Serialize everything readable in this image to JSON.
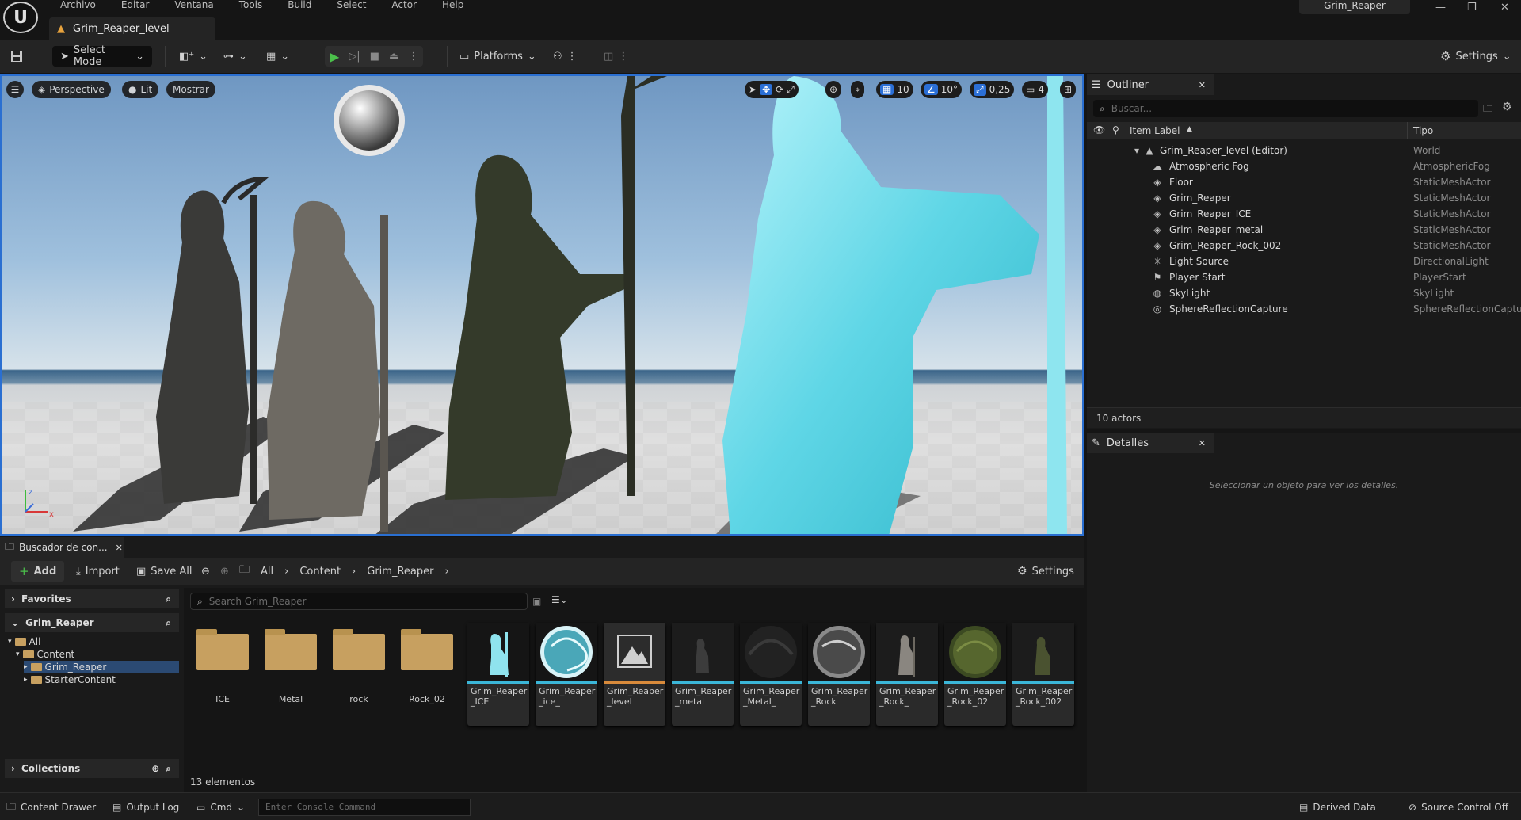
{
  "menu": [
    "Archivo",
    "Editar",
    "Ventana",
    "Tools",
    "Build",
    "Select",
    "Actor",
    "Help"
  ],
  "level_tab": "Grim_Reaper_level",
  "project_name": "Grim_Reaper",
  "toolbar": {
    "select_mode": "Select Mode",
    "platforms": "Platforms",
    "settings": "Settings"
  },
  "viewport": {
    "perspective": "Perspective",
    "lit": "Lit",
    "show": "Mostrar",
    "grid_snap": "10",
    "rot_snap": "10°",
    "scale_snap": "0,25",
    "camera_speed": "4"
  },
  "outliner": {
    "tab": "Outliner",
    "search_placeholder": "Buscar...",
    "col_label": "Item Label",
    "col_type": "Tipo",
    "root": {
      "label": "Grim_Reaper_level (Editor)",
      "type": "World"
    },
    "items": [
      {
        "label": "Atmospheric Fog",
        "type": "AtmosphericFog",
        "icon": "cloud-icon"
      },
      {
        "label": "Floor",
        "type": "StaticMeshActor",
        "icon": "cube-icon"
      },
      {
        "label": "Grim_Reaper",
        "type": "StaticMeshActor",
        "icon": "cube-icon"
      },
      {
        "label": "Grim_Reaper_ICE",
        "type": "StaticMeshActor",
        "icon": "cube-icon"
      },
      {
        "label": "Grim_Reaper_metal",
        "type": "StaticMeshActor",
        "icon": "cube-icon"
      },
      {
        "label": "Grim_Reaper_Rock_002",
        "type": "StaticMeshActor",
        "icon": "cube-icon"
      },
      {
        "label": "Light Source",
        "type": "DirectionalLight",
        "icon": "sun-icon"
      },
      {
        "label": "Player Start",
        "type": "PlayerStart",
        "icon": "flag-icon"
      },
      {
        "label": "SkyLight",
        "type": "SkyLight",
        "icon": "skylight-icon"
      },
      {
        "label": "SphereReflectionCapture",
        "type": "SphereReflectionCapture",
        "icon": "sphere-icon"
      }
    ],
    "count": "10 actors"
  },
  "details": {
    "tab": "Detalles",
    "empty": "Seleccionar un objeto para ver los detalles."
  },
  "content_browser": {
    "tab": "Buscador de con...",
    "add": "Add",
    "import": "Import",
    "save_all": "Save All",
    "breadcrumb": [
      "All",
      "Content",
      "Grim_Reaper"
    ],
    "settings": "Settings",
    "favorites": "Favorites",
    "section": "Grim_Reaper",
    "tree": {
      "all": "All",
      "content": "Content",
      "grim": "Grim_Reaper",
      "starter": "StarterContent"
    },
    "collections": "Collections",
    "search_placeholder": "Search Grim_Reaper",
    "folders": [
      "ICE",
      "Metal",
      "rock",
      "Rock_02"
    ],
    "assets": [
      {
        "name": "Grim_Reaper_ICE",
        "bar": "#3bb6d8"
      },
      {
        "name": "Grim_Reaper_ice_",
        "bar": "#3bb6d8"
      },
      {
        "name": "Grim_Reaper_level",
        "bar": "#d88a3b"
      },
      {
        "name": "Grim_Reaper_metal",
        "bar": "#3bb6d8"
      },
      {
        "name": "Grim_Reaper_Metal_",
        "bar": "#3bb6d8"
      },
      {
        "name": "Grim_Reaper_Rock",
        "bar": "#3bb6d8"
      },
      {
        "name": "Grim_Reaper_Rock_",
        "bar": "#3bb6d8"
      },
      {
        "name": "Grim_Reaper_Rock_02",
        "bar": "#3bb6d8"
      },
      {
        "name": "Grim_Reaper_Rock_002",
        "bar": "#3bb6d8"
      }
    ],
    "count": "13 elementos"
  },
  "statusbar": {
    "content_drawer": "Content Drawer",
    "output_log": "Output Log",
    "cmd": "Cmd",
    "console_placeholder": "Enter Console Command",
    "derived_data": "Derived Data",
    "source_control": "Source Control Off"
  }
}
